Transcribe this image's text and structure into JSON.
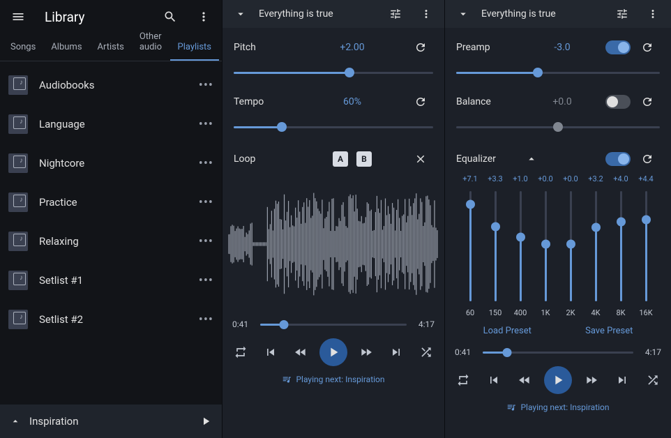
{
  "sidebar": {
    "title": "Library",
    "tabs": [
      "Songs",
      "Albums",
      "Artists",
      "Other audio",
      "Playlists"
    ],
    "active_tab": 4,
    "playlists": [
      "Audiobooks",
      "Language",
      "Nightcore",
      "Practice",
      "Relaxing",
      "Setlist #1",
      "Setlist #2"
    ],
    "footer": {
      "name": "Inspiration"
    }
  },
  "panel_left": {
    "title": "Everything is true",
    "pitch": {
      "label": "Pitch",
      "value": "+2.00"
    },
    "tempo": {
      "label": "Tempo",
      "value": "60%"
    },
    "loop": {
      "label": "Loop",
      "a": "A",
      "b": "B"
    },
    "time_cur": "0:41",
    "time_tot": "4:17",
    "next": "Playing next: Inspiration"
  },
  "panel_right": {
    "title": "Everything is true",
    "preamp": {
      "label": "Preamp",
      "value": "-3.0",
      "on": true
    },
    "balance": {
      "label": "Balance",
      "value": "+0.0",
      "on": false
    },
    "equalizer": {
      "label": "Equalizer",
      "on": true,
      "bands": [
        {
          "v": "+7.1",
          "f": "60",
          "p": 88
        },
        {
          "v": "+3.3",
          "f": "150",
          "p": 68
        },
        {
          "v": "+1.0",
          "f": "400",
          "p": 58
        },
        {
          "v": "+0.0",
          "f": "1K",
          "p": 52
        },
        {
          "v": "+0.0",
          "f": "2K",
          "p": 52
        },
        {
          "v": "+3.2",
          "f": "4K",
          "p": 67
        },
        {
          "v": "+4.0",
          "f": "8K",
          "p": 72
        },
        {
          "v": "+4.4",
          "f": "16K",
          "p": 74
        }
      ],
      "load": "Load Preset",
      "save": "Save Preset"
    },
    "time_cur": "0:41",
    "time_tot": "4:17",
    "next": "Playing next: Inspiration"
  }
}
